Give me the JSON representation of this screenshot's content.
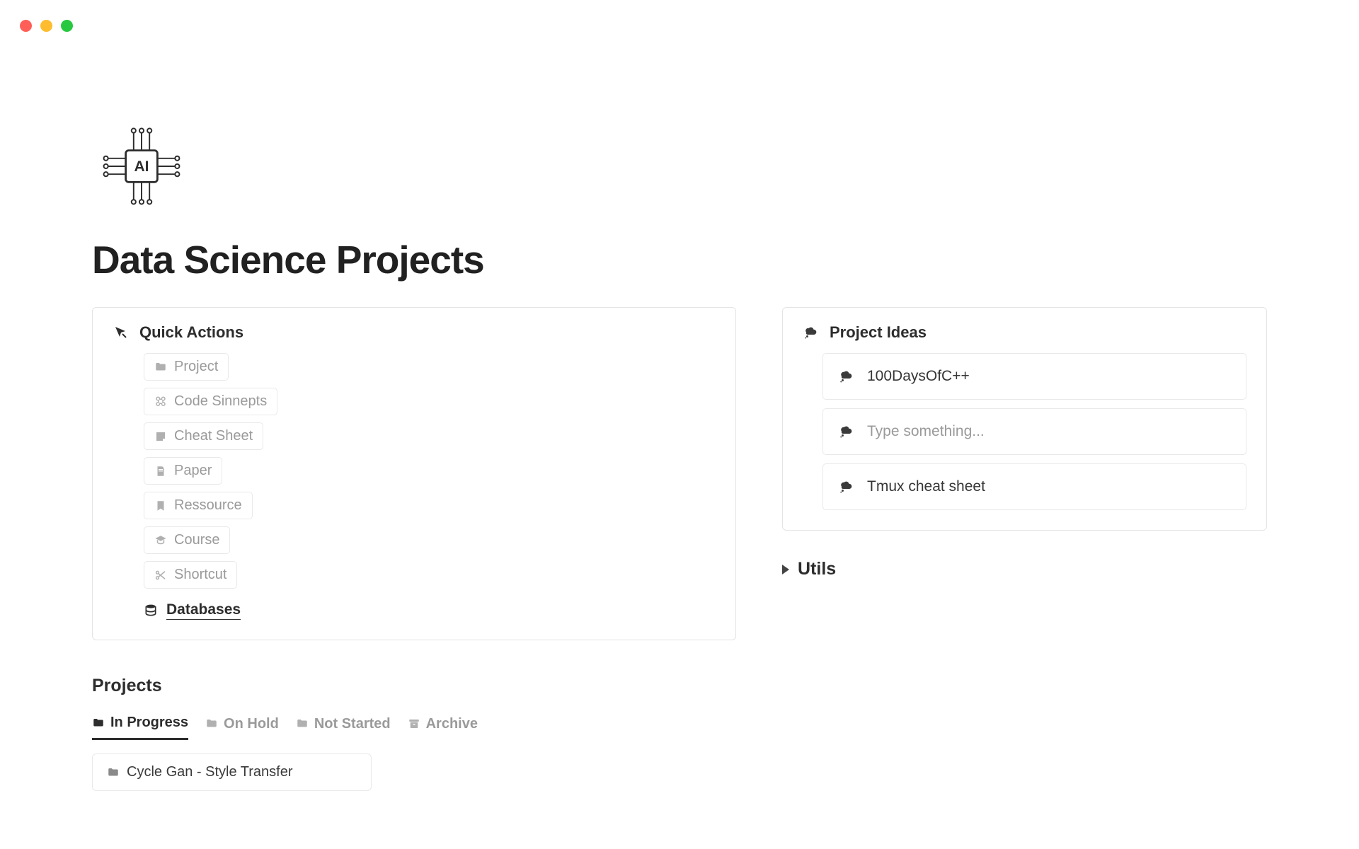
{
  "page": {
    "title": "Data Science Projects"
  },
  "quick_actions": {
    "title": "Quick Actions",
    "items": [
      {
        "icon": "folder",
        "label": "Project"
      },
      {
        "icon": "command",
        "label": "Code Sinnepts"
      },
      {
        "icon": "note",
        "label": "Cheat Sheet"
      },
      {
        "icon": "page",
        "label": "Paper"
      },
      {
        "icon": "bookmark",
        "label": "Ressource"
      },
      {
        "icon": "grad",
        "label": "Course"
      },
      {
        "icon": "scissors",
        "label": "Shortcut"
      }
    ],
    "databases_label": "Databases"
  },
  "project_ideas": {
    "title": "Project Ideas",
    "items": [
      {
        "label": "100DaysOfC++",
        "placeholder": false
      },
      {
        "label": "Type something...",
        "placeholder": true
      },
      {
        "label": "Tmux cheat sheet",
        "placeholder": false
      }
    ]
  },
  "utils": {
    "label": "Utils"
  },
  "projects": {
    "heading": "Projects",
    "tabs": [
      {
        "label": "In Progress",
        "active": true
      },
      {
        "label": "On Hold",
        "active": false
      },
      {
        "label": "Not Started",
        "active": false
      },
      {
        "label": "Archive",
        "active": false
      }
    ],
    "card_label": "Cycle Gan - Style Transfer"
  }
}
